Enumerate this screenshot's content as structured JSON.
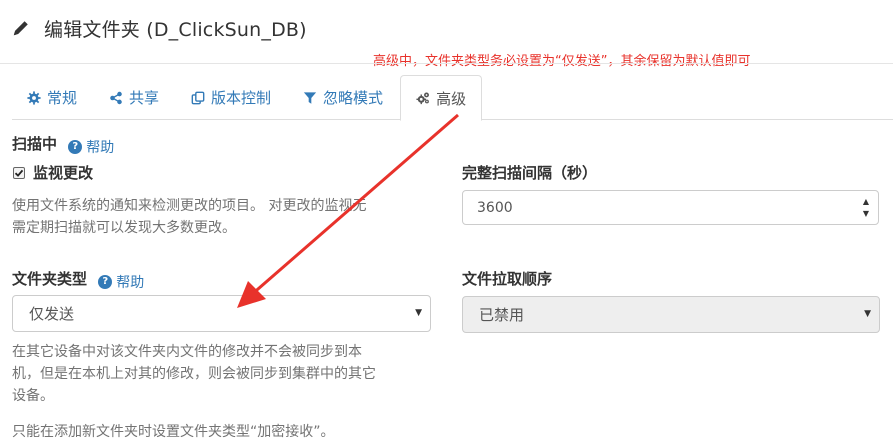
{
  "header": {
    "title": "编辑文件夹 (D_ClickSun_DB)",
    "icon": "pencil-icon"
  },
  "annotation": {
    "text": "高级中，文件夹类型务必设置为“仅发送”，其余保留为默认值即可",
    "color": "#e8322b"
  },
  "tabs": [
    {
      "label": "常规",
      "icon": "gear-icon",
      "active": false
    },
    {
      "label": "共享",
      "icon": "share-icon",
      "active": false
    },
    {
      "label": "版本控制",
      "icon": "copy-icon",
      "active": false
    },
    {
      "label": "忽略模式",
      "icon": "filter-icon",
      "active": false
    },
    {
      "label": "高级",
      "icon": "cogs-icon",
      "active": true
    }
  ],
  "scanning": {
    "title": "扫描中",
    "help_label": "帮助",
    "watch_label": "监视更改",
    "watch_checked": true,
    "watch_help": [
      "使用文件系统的通知来检测更改的项目。 对更改的监视无",
      "需定期扫描就可以发现大多数更改。"
    ]
  },
  "rescan": {
    "label": "完整扫描间隔（秒）",
    "value": "3600"
  },
  "folder_type": {
    "label": "文件夹类型",
    "help_label": "帮助",
    "selected": "仅发送",
    "help_lines": [
      "在其它设备中对该文件夹内文件的修改并不会被同步到本",
      "机，但是在本机上对其的修改，则会被同步到集群中的其它",
      "设备。"
    ],
    "note": "只能在添加新文件夹时设置文件夹类型“加密接收”。"
  },
  "pull_order": {
    "label": "文件拉取顺序",
    "selected": "已禁用",
    "disabled": true
  },
  "colors": {
    "link": "#337ab7",
    "annotation": "#e8322b",
    "muted_text": "#737373"
  }
}
